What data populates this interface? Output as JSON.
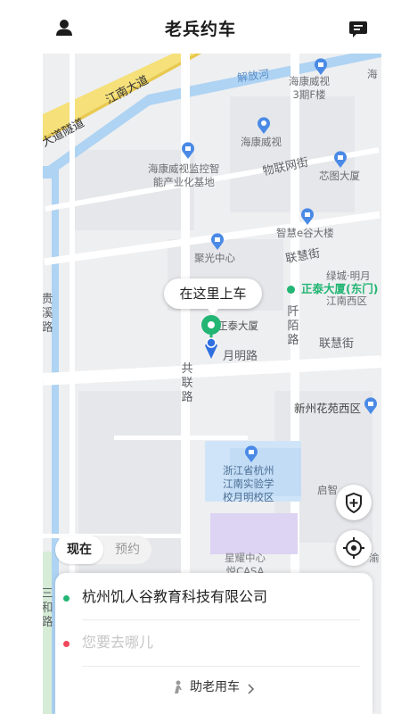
{
  "app": {
    "title": "老兵约车"
  },
  "header": {
    "left_icon": "user-icon",
    "right_icon": "message-icon"
  },
  "map": {
    "labels": {
      "river": "解放河",
      "road_jiangnan": "江南大道",
      "tunnel_prefix": "大道隧道",
      "haikang_3f": "海康威视\n3期F楼",
      "haikang_prefix": "海",
      "haikang": "海康威视",
      "haikang_industry": "海康威视监控智\n能产业化基地",
      "wulian": "物联网街",
      "xintu": "芯图大厦",
      "zhihui": "智慧e谷大楼",
      "juguang": "聚光中心",
      "lianhui": "联慧街",
      "zhengtai_green": "正泰大厦(东门)",
      "lucheng": "绿城·明月",
      "jiangnan_xiyuan": "江南西区",
      "qianmo": "阡陌路",
      "zhengtai": "正泰大厦",
      "yueming": "月明路",
      "lianhui2": "联慧街",
      "gonglian": "共联路",
      "xinzhou": "新州花苑西区",
      "school": "浙江省杭州\n江南实验学\n校月明校区",
      "qi": "启智",
      "xingyao": "星耀中心\n悦CASA",
      "west_road": "贵溪路",
      "west_road2": "三和路",
      "right_cut": "渝"
    }
  },
  "pickup": {
    "bubble": "在这里上车"
  },
  "controls": {
    "safety_icon": "shield-plus-icon",
    "locate_icon": "crosshair-icon"
  },
  "tabs": {
    "now": "现在",
    "reserve": "预约"
  },
  "panel": {
    "origin": "杭州饥人谷教育科技有限公司",
    "destination_placeholder": "您要去哪儿",
    "elder_label": "助老用车",
    "elder_icon": "elder-person-icon",
    "chevron": "chevron-right-icon"
  },
  "colors": {
    "accent_green": "#22b573",
    "destination_red": "#f0475a",
    "route_blue": "#2f6fe0",
    "highway_yellow": "#f5e07a",
    "river_blue": "#aed3f3",
    "poi_blue": "#4a8ae6"
  }
}
